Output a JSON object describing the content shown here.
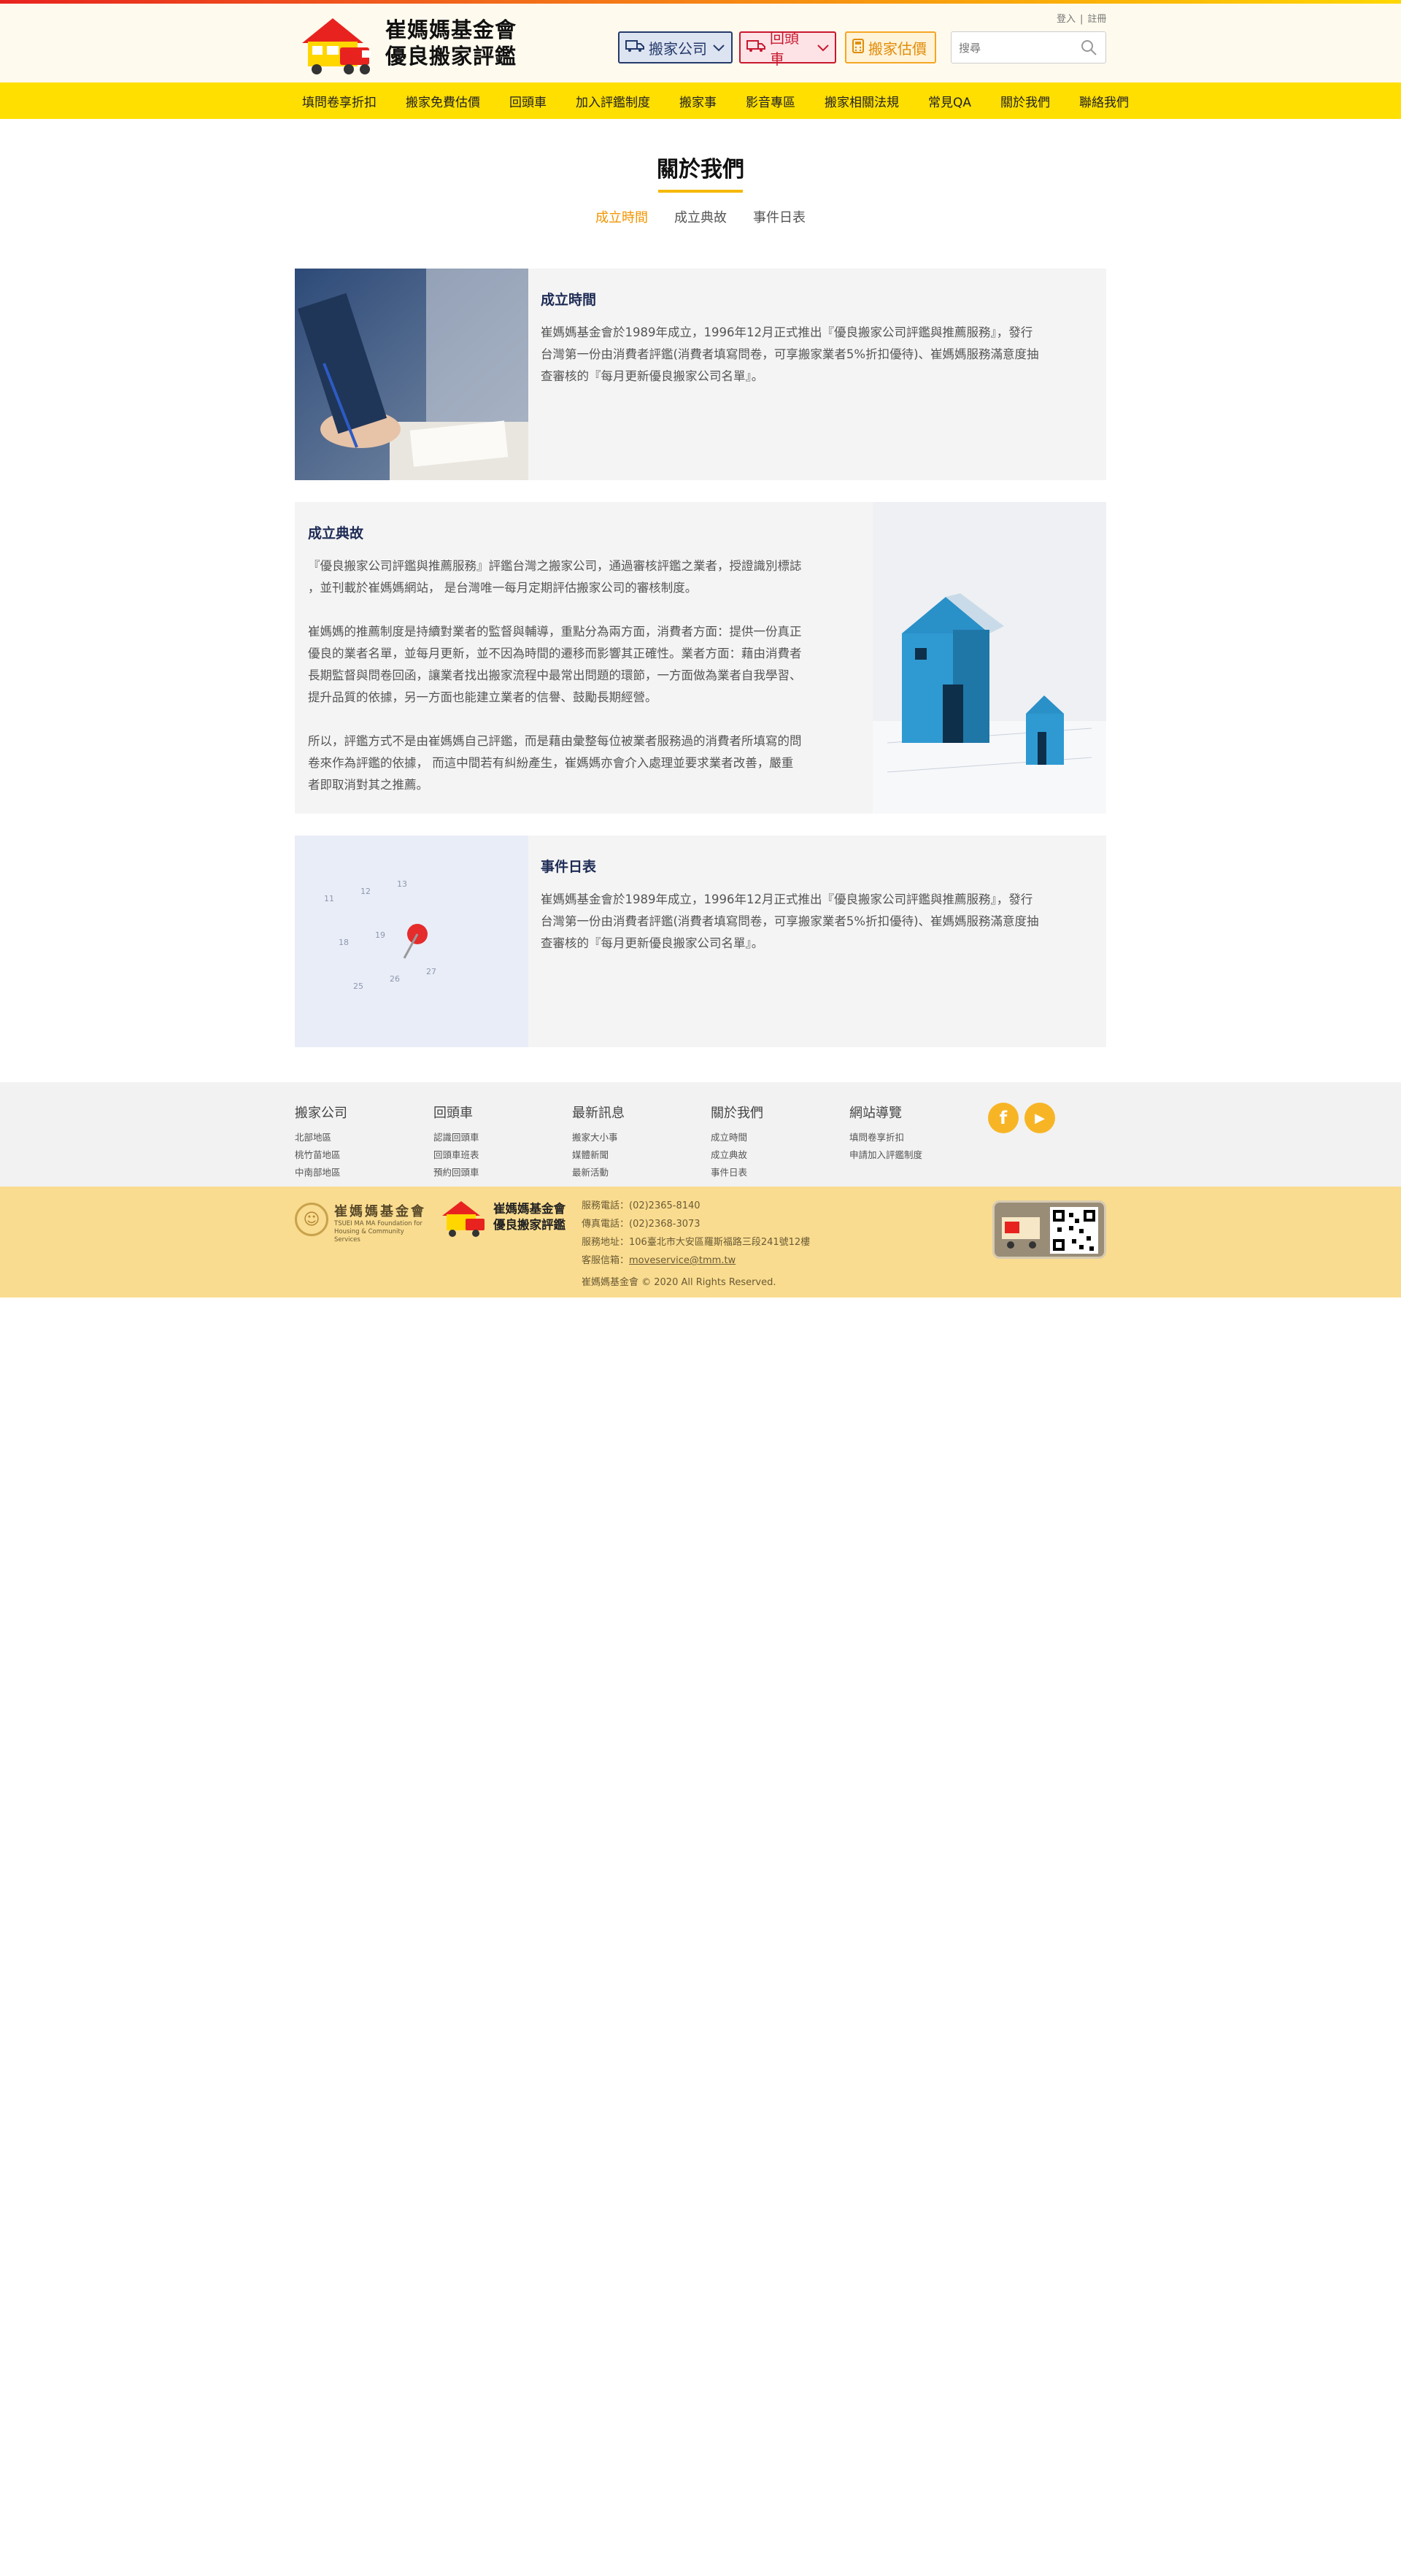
{
  "header": {
    "logo_text": "崔媽媽基金會\n優良搬家評鑑",
    "login": "登入",
    "register": "註冊",
    "separator": "|",
    "btn_move": "搬家公司",
    "btn_return": "回頭車",
    "btn_estimate": "搬家估價",
    "search_placeholder": "搜尋"
  },
  "nav": {
    "items": [
      "填問卷享折扣",
      "搬家免費估價",
      "回頭車",
      "加入評鑑制度",
      "搬家事",
      "影音專區",
      "搬家相關法規",
      "常見QA",
      "關於我們",
      "聯絡我們"
    ]
  },
  "page": {
    "title": "關於我們",
    "tabs": [
      {
        "label": "成立時間",
        "active": true
      },
      {
        "label": "成立典故",
        "active": false
      },
      {
        "label": "事件日表",
        "active": false
      }
    ]
  },
  "cards": [
    {
      "title": "成立時間",
      "body": "崔媽媽基金會於1989年成立，1996年12月正式推出『優良搬家公司評鑑與推薦服務』，發行\n台灣第一份由消費者評鑑(消費者填寫問卷，可享搬家業者5%折扣優待)、崔媽媽服務滿意度抽\n查審核的『每月更新優良搬家公司名單』。"
    },
    {
      "title": "成立典故",
      "body": "『優良搬家公司評鑑與推薦服務』評鑑台灣之搬家公司，通過審核評鑑之業者，授證識別標誌\n，並刊載於崔媽媽網站， 是台灣唯一每月定期評估搬家公司的審核制度。\n\n崔媽媽的推薦制度是持續對業者的監督與輔導，重點分為兩方面，消費者方面：提供一份真正\n優良的業者名單，並每月更新，並不因為時間的遷移而影響其正確性。業者方面：藉由消費者\n長期監督與問卷回函，讓業者找出搬家流程中最常出問題的環節，一方面做為業者自我學習、\n提升品質的依據，另一方面也能建立業者的信譽、鼓勵長期經營。\n\n所以，評鑑方式不是由崔媽媽自己評鑑，而是藉由彙整每位被業者服務過的消費者所填寫的問\n卷來作為評鑑的依據， 而這中間若有糾紛產生，崔媽媽亦會介入處理並要求業者改善，嚴重\n者即取消對其之推薦。"
    },
    {
      "title": "事件日表",
      "body": "崔媽媽基金會於1989年成立，1996年12月正式推出『優良搬家公司評鑑與推薦服務』，發行\n台灣第一份由消費者評鑑(消費者填寫問卷，可享搬家業者5%折扣優待)、崔媽媽服務滿意度抽\n查審核的『每月更新優良搬家公司名單』。"
    }
  ],
  "footer": {
    "columns": [
      {
        "title": "搬家公司",
        "links": [
          "北部地區",
          "桃竹苗地區",
          "中南部地區"
        ]
      },
      {
        "title": "回頭車",
        "links": [
          "認識回頭車",
          "回頭車班表",
          "預約回頭車"
        ]
      },
      {
        "title": "最新訊息",
        "links": [
          "搬家大小事",
          "媒體新聞",
          "最新活動"
        ]
      },
      {
        "title": "關於我們",
        "links": [
          "成立時間",
          "成立典故",
          "事件日表"
        ]
      },
      {
        "title": "網站導覽",
        "links": [
          "填問卷享折扣",
          "申請加入評鑑制度"
        ]
      }
    ],
    "social": {
      "facebook": "f",
      "youtube": "▶"
    },
    "foundation_name": "崔媽媽基金會",
    "foundation_en": "TSUEI MA MA Foundation for\nHousing & Community Services",
    "small_logo_text": "崔媽媽基金會\n優良搬家評鑑",
    "contact": {
      "phone": "服務電話：(02)2365-8140",
      "fax": "傳真電話：(02)2368-3073",
      "address": "服務地址：106臺北市大安區羅斯福路三段241號12樓",
      "email_label": "客服信箱：",
      "email": "moveservice@tmm.tw"
    },
    "copyright": "崔媽媽基金會 © 2020 All Rights Reserved."
  }
}
